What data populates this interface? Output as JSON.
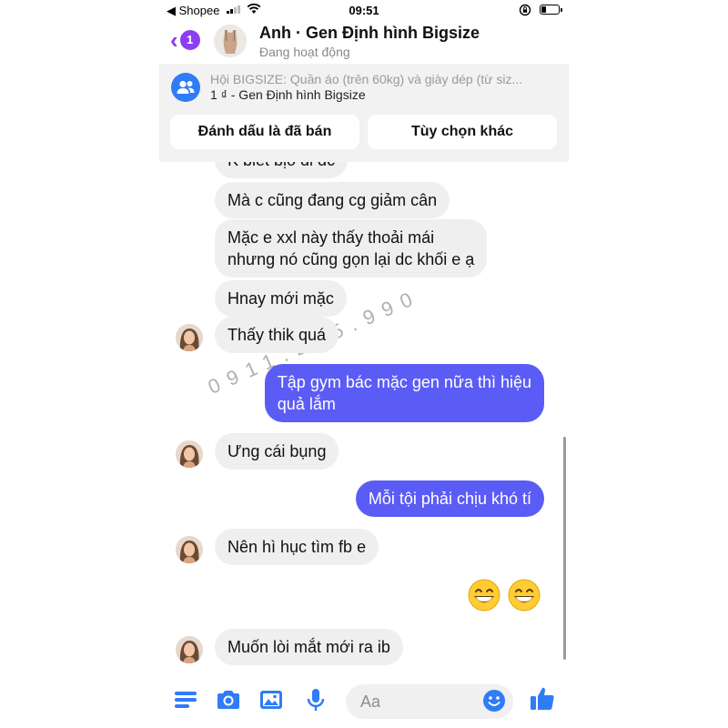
{
  "status_bar": {
    "back_app": "◀ Shopee",
    "time": "09:51",
    "battery_level": 0.3
  },
  "header": {
    "unread_count": "1",
    "title": "Anh · Gen Định hình Bigsize",
    "status": "Đang hoạt động"
  },
  "product": {
    "group_line": "Hội BIGSIZE: Quần áo (trên 60kg) và giày dép (từ siz...",
    "item_line": "1 ₫ - Gen Định hình Bigsize",
    "mark_sold_label": "Đánh dấu là đã bán",
    "more_options_label": "Tùy chọn khác"
  },
  "messages": [
    {
      "side": "in",
      "text": "K biết bịo đi đc",
      "avatar": false
    },
    {
      "side": "in",
      "text": "Mà c cũng đang cg giảm cân",
      "avatar": false
    },
    {
      "side": "in",
      "text": "Mặc e xxl này thấy thoải mái\nnhưng nó cũng gọn lại dc khối e ạ",
      "avatar": false
    },
    {
      "side": "in",
      "text": "Hnay mới mặc",
      "avatar": false
    },
    {
      "side": "in",
      "text": "Thấy thik quá",
      "avatar": true
    },
    {
      "side": "out",
      "text": "Tập gym bác mặc gen nữa thì hiệu\nquả lắm",
      "avatar": false
    },
    {
      "side": "in",
      "text": "Ưng cái bụng",
      "avatar": true
    },
    {
      "side": "out",
      "text": "Mỗi tội phải chịu khó tí",
      "avatar": false
    },
    {
      "side": "in",
      "text": "Nên hì hục tìm fb  e",
      "avatar": true
    },
    {
      "side": "out",
      "text": "😁😁",
      "avatar": false
    },
    {
      "side": "in",
      "text": "Muốn lòi mắt mới ra ib",
      "avatar": true
    }
  ],
  "watermark": "0911.255.990",
  "input": {
    "placeholder": "Aa",
    "icons": [
      "menu-icon",
      "camera-icon",
      "gallery-icon",
      "microphone-icon",
      "emoji-icon",
      "like-icon"
    ]
  },
  "colors": {
    "accent": "#8a3ff0",
    "outgoing_bubble": "#5b5cf6",
    "incoming_bubble": "#efefef",
    "icon_blue": "#2f7cf6"
  }
}
